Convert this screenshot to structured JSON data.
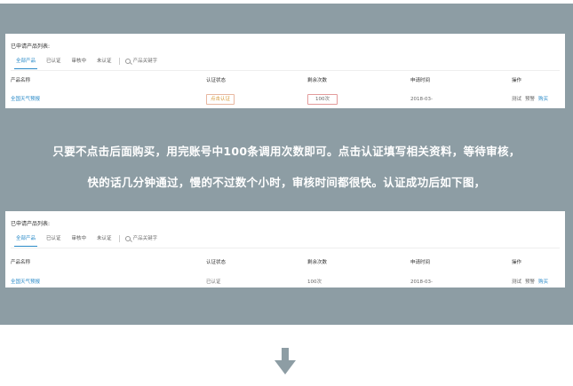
{
  "colors": {
    "banner_bg": "#8d9da4",
    "link": "#2a8ac8",
    "arrow": "#8d9da4"
  },
  "panel_top": {
    "title": "已申请产品列表:",
    "tabs": [
      "全部产品",
      "已认证",
      "审核中",
      "未认证"
    ],
    "active_tab": "全部产品",
    "search_placeholder": "产品关键字",
    "columns": [
      "产品名称",
      "认证状态",
      "剩余次数",
      "申请时间",
      "操作"
    ],
    "row": {
      "name": "全国天气预报",
      "status": "点击认证",
      "remaining": "100次",
      "time": "2018-03-",
      "ops": [
        "测试",
        "预警",
        "购买"
      ]
    }
  },
  "caption": {
    "line1": "只要不点击后面购买，用完账号中100条调用次数即可。点击认证填写相关资料，等待审核，",
    "line2": "快的话几分钟通过，慢的不过数个小时，审核时间都很快。认证成功后如下图，"
  },
  "panel_bottom": {
    "title": "已申请产品列表:",
    "tabs": [
      "全部产品",
      "已认证",
      "审核中",
      "未认证"
    ],
    "active_tab": "全部产品",
    "search_placeholder": "产品关键字",
    "columns": [
      "产品名称",
      "认证状态",
      "剩余次数",
      "申请时间",
      "操作"
    ],
    "row": {
      "name": "全国天气预报",
      "status": "已认证",
      "remaining": "100次",
      "time": "2018-03-",
      "ops": [
        "测试",
        "预警",
        "购买"
      ]
    }
  },
  "icons": {
    "search": "search-icon",
    "arrow": "arrow-down-icon"
  }
}
